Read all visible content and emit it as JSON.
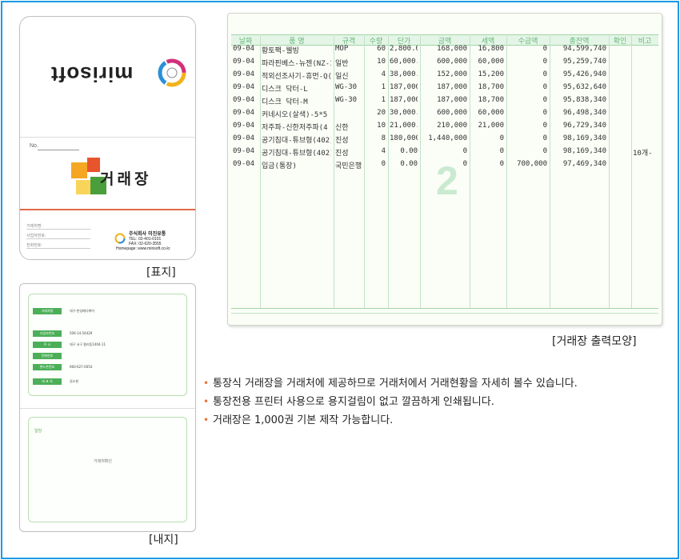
{
  "cover": {
    "logo_text": "mirisoft",
    "title": "거래장",
    "no_label": "No.",
    "fields": [
      "거래처명:",
      "사업자번호:",
      "전화번호:"
    ],
    "company_name": "주식회사 미진유통",
    "company_tel": "TEL: 02-401-0101",
    "company_fax": "FAX: 02-620-3555",
    "company_web": "Homepage: www.mirisoft.co.kr"
  },
  "inner": {
    "rows": [
      {
        "label": "거래처명",
        "value": "대구-한성메디케어"
      },
      {
        "label": "사업자번호",
        "value": "506-14-54429"
      },
      {
        "label": "주 소",
        "value": "대구 서구 평리동1404-11"
      },
      {
        "label": "전화번호",
        "value": ""
      },
      {
        "label": "핸드폰번호",
        "value": "060-627-0054"
      },
      {
        "label": "대 표 자",
        "value": "권소현"
      }
    ],
    "bottom_label": "일당",
    "bottom_text": "거래처확인"
  },
  "captions": {
    "cover": "[표지]",
    "inner": "[내지]",
    "ledger": "[거래장 출력모양]"
  },
  "ledger": {
    "headers": [
      "날짜",
      "품 명",
      "규격",
      "수량",
      "단가",
      "금액",
      "세액",
      "수금액",
      "총잔액",
      "확인",
      "비고"
    ],
    "watermark": "2",
    "rows": [
      [
        "09-04",
        "황토팩-웰빙",
        "MOP",
        "60",
        "2,800.00",
        "168,000",
        "16,800",
        "0",
        "94,599,740",
        "",
        ""
      ],
      [
        "09-04",
        "파라핀베스-뉴젠(NZ-1",
        "일반",
        "10",
        "60,000.00",
        "600,000",
        "60,000",
        "0",
        "95,259,740",
        "",
        ""
      ],
      [
        "09-04",
        "적외선조사기-휴먼-Q(",
        "일신",
        "4",
        "38,000.00",
        "152,000",
        "15,200",
        "0",
        "95,426,940",
        "",
        ""
      ],
      [
        "09-04",
        "디스크 닥터-L",
        "WG-30",
        "1",
        "187,000.0",
        "187,000",
        "18,700",
        "0",
        "95,632,640",
        "",
        ""
      ],
      [
        "09-04",
        "디스크 닥터-M",
        "WG-30",
        "1",
        "187,000.0",
        "187,000",
        "18,700",
        "0",
        "95,838,340",
        "",
        ""
      ],
      [
        "09-04",
        "커네시오(살색)-5*5",
        "",
        "20",
        "30,000.00",
        "600,000",
        "60,000",
        "0",
        "96,498,340",
        "",
        ""
      ],
      [
        "09-04",
        "저주파-신한저주파(4",
        "신한",
        "10",
        "21,000.00",
        "210,000",
        "21,000",
        "0",
        "96,729,340",
        "",
        ""
      ],
      [
        "09-04",
        "공기침대-튜브형(402)",
        "진성",
        "8",
        "180,000.0",
        "1,440,000",
        "0",
        "0",
        "98,169,340",
        "",
        ""
      ],
      [
        "09-04",
        "공기침대-튜브형(402)",
        "진성",
        "4",
        "0.00",
        "0",
        "0",
        "0",
        "98,169,340",
        "",
        "10개-"
      ],
      [
        "09-04",
        "입금(통장)",
        "국민은행 (",
        "0",
        "0.00",
        "0",
        "0",
        "700,000",
        "97,469,340",
        "",
        ""
      ]
    ]
  },
  "bullets": [
    "통장식 거래장을 거래처에 제공하므로 거래처에서 거래현황을 자세히 볼수 있습니다.",
    "통장전용 프린터 사용으로 용지걸림이 없고 깔끔하게 인쇄됩니다.",
    "거래장은 1,000권 기본 제작 가능합니다."
  ],
  "colors": {
    "border": "#1a9be3",
    "bullet": "#e8743c",
    "ledger_green": "#66b87a",
    "cover_red": "#e0694a"
  }
}
